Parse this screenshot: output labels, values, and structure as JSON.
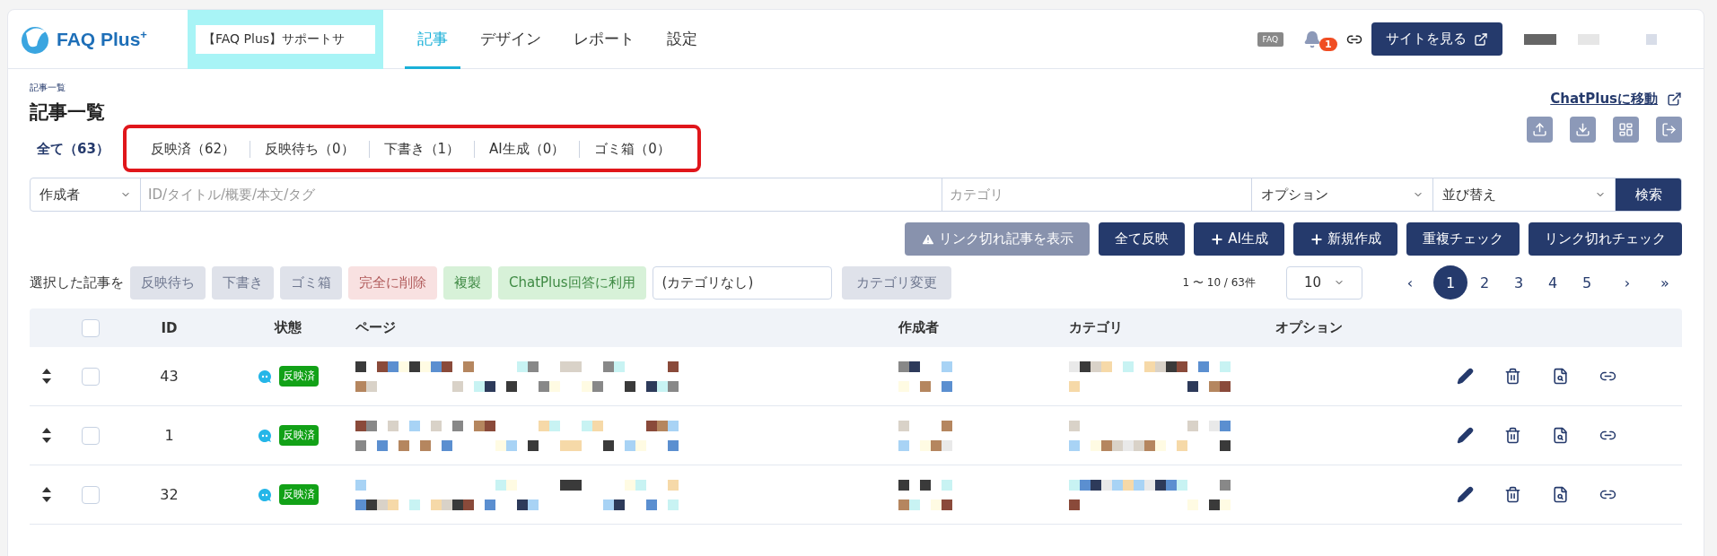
{
  "header": {
    "logo_text": "FAQ Plus",
    "logo_sup": "+",
    "site_selector": {
      "value": "【FAQ Plus】サポートサ"
    },
    "nav": [
      {
        "label": "記事",
        "selected": true
      },
      {
        "label": "デザイン",
        "selected": false
      },
      {
        "label": "レポート",
        "selected": false
      },
      {
        "label": "設定",
        "selected": false
      }
    ],
    "faq_icon_label": "FAQ",
    "notification_count": "1",
    "view_site_button": "サイトを見る"
  },
  "breadcrumb": "記事一覧",
  "title": "記事一覧",
  "chatplus_link": "ChatPlusに移動",
  "filter_tabs": [
    {
      "label": "全て（63）",
      "selected": true
    },
    {
      "label": "反映済（62）",
      "selected": false
    },
    {
      "label": "反映待ち（0）",
      "selected": false
    },
    {
      "label": "下書き（1）",
      "selected": false
    },
    {
      "label": "AI生成（0）",
      "selected": false
    },
    {
      "label": "ゴミ箱（0）",
      "selected": false
    }
  ],
  "search": {
    "author_select": "作成者",
    "keyword_placeholder": "ID/タイトル/概要/本文/タグ",
    "category_placeholder": "カテゴリ",
    "option_select": "オプション",
    "sort_select": "並び替え",
    "button": "検索"
  },
  "actions": [
    {
      "label": "リンク切れ記事を表示",
      "kind": "warning"
    },
    {
      "label": "全て反映",
      "kind": "plain"
    },
    {
      "label": "AI生成",
      "kind": "add"
    },
    {
      "label": "新規作成",
      "kind": "add"
    },
    {
      "label": "重複チェック",
      "kind": "plain"
    },
    {
      "label": "リンク切れチェック",
      "kind": "plain"
    }
  ],
  "bulk": {
    "label": "選択した記事を",
    "buttons": [
      {
        "label": "反映待ち",
        "kind": "grey",
        "disabled": true
      },
      {
        "label": "下書き",
        "kind": "grey",
        "disabled": true
      },
      {
        "label": "ゴミ箱",
        "kind": "grey",
        "disabled": true
      },
      {
        "label": "完全に削除",
        "kind": "danger",
        "disabled": true
      },
      {
        "label": "複製",
        "kind": "success",
        "disabled": true
      },
      {
        "label": "ChatPlus回答に利用",
        "kind": "success",
        "disabled": true
      }
    ],
    "category_value": "(カテゴリなし)",
    "change_button": {
      "label": "カテゴリ変更",
      "disabled": true
    }
  },
  "pagination": {
    "range": "1 〜 10 / 63件",
    "per_page": "10",
    "prev": "‹",
    "pages": [
      {
        "label": "1",
        "selected": true
      },
      {
        "label": "2",
        "selected": false
      },
      {
        "label": "3",
        "selected": false
      },
      {
        "label": "4",
        "selected": false
      },
      {
        "label": "5",
        "selected": false
      }
    ],
    "next": "›",
    "last": "»"
  },
  "table": {
    "select_all_checked": false,
    "columns": [
      "ID",
      "状態",
      "ページ",
      "作成者",
      "カテゴリ",
      "オプション"
    ],
    "rows": [
      {
        "id": "43",
        "status": "反映済",
        "checked": false
      },
      {
        "id": "1",
        "status": "反映済",
        "checked": false
      },
      {
        "id": "32",
        "status": "反映済",
        "checked": false
      }
    ]
  }
}
